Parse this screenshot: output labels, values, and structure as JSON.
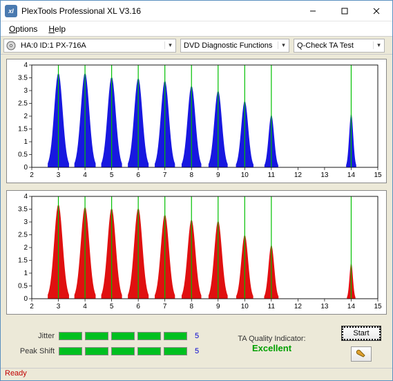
{
  "window": {
    "title": "PlexTools Professional XL V3.16",
    "app_icon_text": "xl"
  },
  "menu": {
    "options": "Options",
    "help": "Help"
  },
  "toolbar": {
    "drive": "HA:0 ID:1   PX-716A",
    "category": "DVD Diagnostic Functions",
    "test": "Q-Check TA Test"
  },
  "panel": {
    "jitter_label": "Jitter",
    "jitter_value": "5",
    "peakshift_label": "Peak Shift",
    "peakshift_value": "5",
    "ta_label": "TA Quality Indicator:",
    "ta_value": "Excellent",
    "start_label": "Start"
  },
  "status": {
    "text": "Ready"
  },
  "chart_data": [
    {
      "type": "bar",
      "color": "#1818e0",
      "xlim": [
        2,
        15
      ],
      "ylim": [
        0,
        4
      ],
      "xticks": [
        2,
        3,
        4,
        5,
        6,
        7,
        8,
        9,
        10,
        11,
        12,
        13,
        14,
        15
      ],
      "yticks": [
        0,
        0.5,
        1,
        1.5,
        2,
        2.5,
        3,
        3.5,
        4
      ],
      "markers": [
        3,
        4,
        5,
        6,
        7,
        8,
        9,
        10,
        11,
        14
      ],
      "peaks": [
        {
          "x": 3,
          "h": 3.7,
          "w": 0.8
        },
        {
          "x": 4,
          "h": 3.7,
          "w": 0.8
        },
        {
          "x": 5,
          "h": 3.55,
          "w": 0.78
        },
        {
          "x": 6,
          "h": 3.5,
          "w": 0.78
        },
        {
          "x": 7,
          "h": 3.4,
          "w": 0.76
        },
        {
          "x": 8,
          "h": 3.2,
          "w": 0.74
        },
        {
          "x": 9,
          "h": 3.0,
          "w": 0.72
        },
        {
          "x": 10,
          "h": 2.6,
          "w": 0.66
        },
        {
          "x": 11,
          "h": 2.05,
          "w": 0.52
        },
        {
          "x": 14,
          "h": 2.1,
          "w": 0.38
        }
      ]
    },
    {
      "type": "bar",
      "color": "#e01010",
      "xlim": [
        2,
        15
      ],
      "ylim": [
        0,
        4
      ],
      "xticks": [
        2,
        3,
        4,
        5,
        6,
        7,
        8,
        9,
        10,
        11,
        12,
        13,
        14,
        15
      ],
      "yticks": [
        0,
        0.5,
        1,
        1.5,
        2,
        2.5,
        3,
        3.5,
        4
      ],
      "markers": [
        3,
        4,
        5,
        6,
        7,
        8,
        9,
        10,
        11,
        14
      ],
      "peaks": [
        {
          "x": 3,
          "h": 3.7,
          "w": 0.8
        },
        {
          "x": 4,
          "h": 3.6,
          "w": 0.8
        },
        {
          "x": 5,
          "h": 3.55,
          "w": 0.78
        },
        {
          "x": 6,
          "h": 3.55,
          "w": 0.78
        },
        {
          "x": 7,
          "h": 3.3,
          "w": 0.76
        },
        {
          "x": 8,
          "h": 3.1,
          "w": 0.74
        },
        {
          "x": 9,
          "h": 3.05,
          "w": 0.72
        },
        {
          "x": 10,
          "h": 2.5,
          "w": 0.64
        },
        {
          "x": 11,
          "h": 2.1,
          "w": 0.54
        },
        {
          "x": 14,
          "h": 1.4,
          "w": 0.32
        }
      ]
    }
  ]
}
